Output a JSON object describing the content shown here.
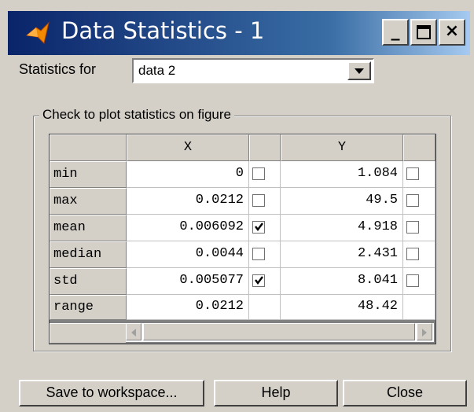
{
  "window": {
    "title": "Data Statistics - 1",
    "minimize_label": "_",
    "maximize_label": "□",
    "close_label": "×"
  },
  "statistics_for": {
    "label": "Statistics for",
    "selected": "data 2"
  },
  "group_label": "Check to plot statistics on figure",
  "table": {
    "headers": [
      "X",
      "Y"
    ],
    "rows": [
      {
        "name": "min",
        "x": "0",
        "x_checked": false,
        "y": "1.084",
        "y_checked": false
      },
      {
        "name": "max",
        "x": "0.0212",
        "x_checked": false,
        "y": "49.5",
        "y_checked": false
      },
      {
        "name": "mean",
        "x": "0.006092",
        "x_checked": true,
        "y": "4.918",
        "y_checked": false
      },
      {
        "name": "median",
        "x": "0.0044",
        "x_checked": false,
        "y": "2.431",
        "y_checked": false
      },
      {
        "name": "std",
        "x": "0.005077",
        "x_checked": true,
        "y": "8.041",
        "y_checked": false
      },
      {
        "name": "range",
        "x": "0.0212",
        "x_checked": null,
        "y": "48.42",
        "y_checked": null
      }
    ]
  },
  "buttons": {
    "save": "Save to workspace...",
    "help": "Help",
    "close": "Close"
  },
  "colors": {
    "titlebar_start": "#0a246a",
    "titlebar_end": "#a6caf0",
    "face": "#d4d0c8",
    "icon_orange": "#f08a00"
  }
}
